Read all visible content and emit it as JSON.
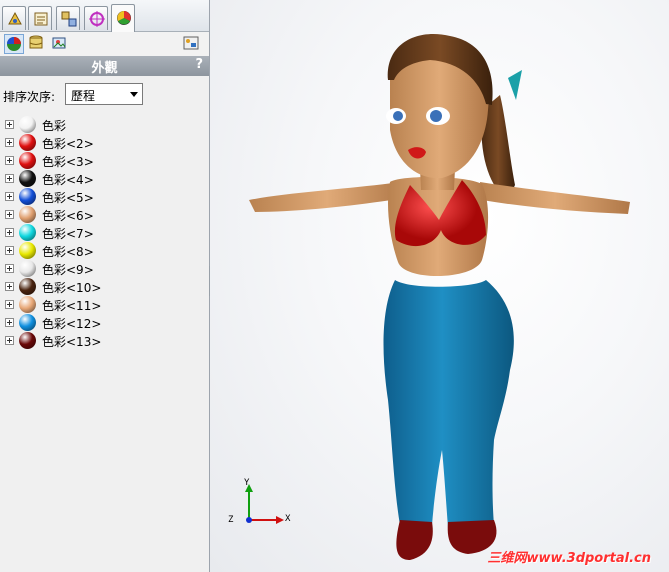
{
  "tabs": [
    {
      "icon": "feature-manager-icon"
    },
    {
      "icon": "property-manager-icon"
    },
    {
      "icon": "configuration-manager-icon"
    },
    {
      "icon": "dimxpert-icon"
    },
    {
      "icon": "appearance-manager-icon",
      "active": true
    }
  ],
  "subtools": [
    {
      "icon": "appearances-icon",
      "selected": true
    },
    {
      "icon": "scenes-icon"
    },
    {
      "icon": "decals-icon"
    },
    {
      "icon": "display-pane-icon"
    }
  ],
  "panel": {
    "title": "外觀",
    "help": "?",
    "sort_label": "排序次序:",
    "sort_value": "歷程"
  },
  "appearances": [
    {
      "label": "色彩",
      "color": "#f2f2f2"
    },
    {
      "label": "色彩<2>",
      "color": "#e01010"
    },
    {
      "label": "色彩<3>",
      "color": "#e01010"
    },
    {
      "label": "色彩<4>",
      "color": "#111111"
    },
    {
      "label": "色彩<5>",
      "color": "#1450d8"
    },
    {
      "label": "色彩<6>",
      "color": "#e0a070"
    },
    {
      "label": "色彩<7>",
      "color": "#10d8e0"
    },
    {
      "label": "色彩<8>",
      "color": "#e8e800"
    },
    {
      "label": "色彩<9>",
      "color": "#e8e8e8"
    },
    {
      "label": "色彩<10>",
      "color": "#4a2410"
    },
    {
      "label": "色彩<11>",
      "color": "#e8a878"
    },
    {
      "label": "色彩<12>",
      "color": "#1090e0"
    },
    {
      "label": "色彩<13>",
      "color": "#6a0808"
    }
  ],
  "triad": {
    "y": "Y",
    "x": "X",
    "z": "Z"
  },
  "watermark": "三维网www.3dportal.cn"
}
